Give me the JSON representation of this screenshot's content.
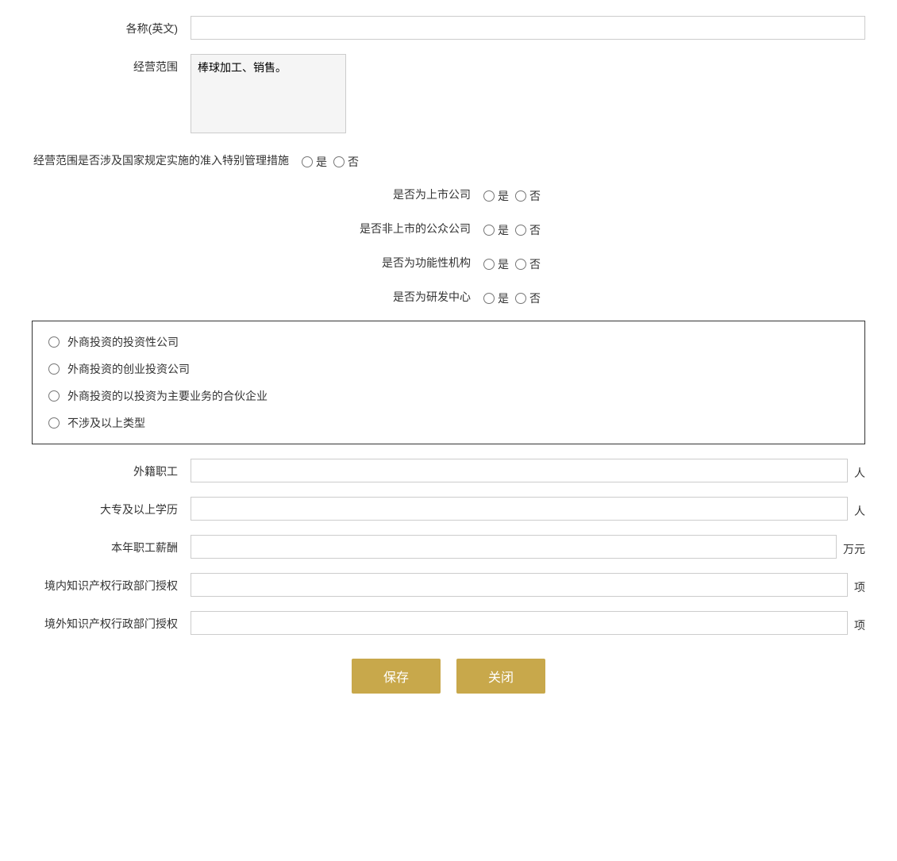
{
  "form": {
    "name_en_label": "各称(英文)",
    "name_en_value": "",
    "business_scope_label": "经营范围",
    "business_scope_value": "棒球加工、销售。",
    "special_management_label": "经营范围是否涉及国家规定实施的准入特别管理措施",
    "is_label": "是",
    "no_label": "否",
    "listed_company_label": "是否为上市公司",
    "non_listed_public_label": "是否非上市的公众公司",
    "functional_org_label": "是否为功能性机构",
    "rd_center_label": "是否为研发中心",
    "checkbox_options": [
      "外商投资的投资性公司",
      "外商投资的创业投资公司",
      "外商投资的以投资为主要业务的合伙企业",
      "不涉及以上类型"
    ],
    "foreign_employees_label": "外籍职工",
    "foreign_employees_value": "",
    "foreign_employees_unit": "人",
    "college_degree_label": "大专及以上学历",
    "college_degree_value": "",
    "college_degree_unit": "人",
    "annual_salary_label": "本年职工薪酬",
    "annual_salary_value": "",
    "annual_salary_unit": "万元",
    "domestic_ip_label": "境内知识产权行政部门授权",
    "domestic_ip_value": "",
    "domestic_ip_unit": "项",
    "foreign_ip_label": "境外知识产权行政部门授权",
    "foreign_ip_value": "",
    "foreign_ip_unit": "项",
    "save_button": "保存",
    "close_button": "关闭"
  }
}
